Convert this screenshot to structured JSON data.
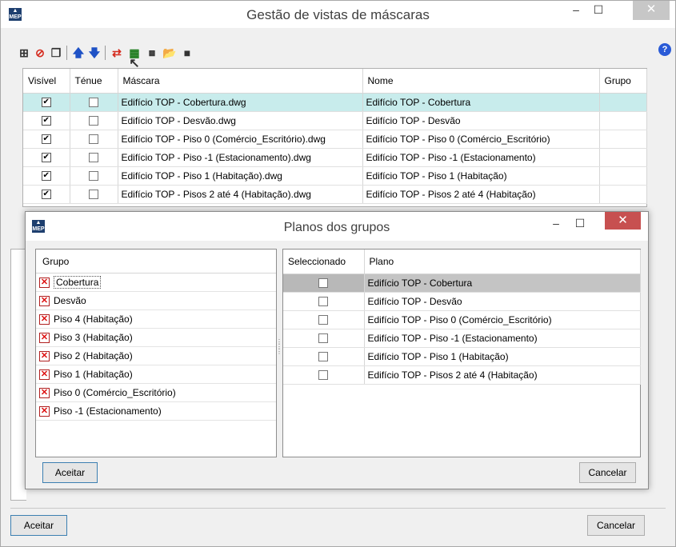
{
  "main_window": {
    "title": "Gestão de vistas de máscaras",
    "app_icon": "MEP",
    "controls": {
      "minimize": "–",
      "maximize": "☐",
      "close": "✕"
    },
    "toolbar": {
      "icons": [
        "add-icon",
        "delete-icon",
        "copy-icon",
        "move-up-icon",
        "move-down-icon",
        "toggle-icon",
        "select-all-icon",
        "dxf-dwg-icon",
        "open-folder-icon",
        "save-icon"
      ]
    },
    "help_label": "?",
    "table": {
      "headers": [
        "Visível",
        "Ténue",
        "Máscara",
        "Nome",
        "Grupo"
      ],
      "rows": [
        {
          "visible": "✔",
          "tenue": "",
          "mascara": "Edifício TOP - Cobertura.dwg",
          "nome": "Edifício TOP - Cobertura",
          "grupo": ""
        },
        {
          "visible": "✔",
          "tenue": "",
          "mascara": "Edifício TOP - Desvão.dwg",
          "nome": "Edifício TOP - Desvão",
          "grupo": ""
        },
        {
          "visible": "✔",
          "tenue": "",
          "mascara": "Edifício TOP - Piso 0 (Comércio_Escritório).dwg",
          "nome": "Edifício TOP - Piso 0 (Comércio_Escritório)",
          "grupo": ""
        },
        {
          "visible": "✔",
          "tenue": "",
          "mascara": "Edifício TOP - Piso -1 (Estacionamento).dwg",
          "nome": "Edifício TOP - Piso -1 (Estacionamento)",
          "grupo": ""
        },
        {
          "visible": "✔",
          "tenue": "",
          "mascara": "Edifício TOP - Piso 1 (Habitação).dwg",
          "nome": "Edifício TOP - Piso 1 (Habitação)",
          "grupo": ""
        },
        {
          "visible": "✔",
          "tenue": "",
          "mascara": "Edifício TOP - Pisos 2 até 4 (Habitação).dwg",
          "nome": "Edifício TOP - Pisos 2 até 4 (Habitação)",
          "grupo": ""
        }
      ]
    },
    "accept_label": "Aceitar",
    "cancel_label": "Cancelar"
  },
  "dialog": {
    "title": "Planos dos grupos",
    "app_icon": "MEP",
    "controls": {
      "minimize": "–",
      "maximize": "☐",
      "close": "✕"
    },
    "groups_header": "Grupo",
    "groups": [
      {
        "label": "Cobertura",
        "mark": "✕"
      },
      {
        "label": "Desvão",
        "mark": "✕"
      },
      {
        "label": "Piso 4 (Habitação)",
        "mark": "✕"
      },
      {
        "label": "Piso 3 (Habitação)",
        "mark": "✕"
      },
      {
        "label": "Piso 2 (Habitação)",
        "mark": "✕"
      },
      {
        "label": "Piso 1 (Habitação)",
        "mark": "✕"
      },
      {
        "label": "Piso 0 (Comércio_Escritório)",
        "mark": "✕"
      },
      {
        "label": "Piso -1 (Estacionamento)",
        "mark": "✕"
      }
    ],
    "plans_headers": [
      "Seleccionado",
      "Plano"
    ],
    "plans": [
      {
        "selected": "",
        "plano": "Edifício TOP - Cobertura"
      },
      {
        "selected": "",
        "plano": "Edifício TOP - Desvão"
      },
      {
        "selected": "",
        "plano": "Edifício TOP - Piso 0 (Comércio_Escritório)"
      },
      {
        "selected": "",
        "plano": "Edifício TOP - Piso -1 (Estacionamento)"
      },
      {
        "selected": "",
        "plano": "Edifício TOP - Piso 1 (Habitação)"
      },
      {
        "selected": "",
        "plano": "Edifício TOP - Pisos 2 até 4 (Habitação)"
      }
    ],
    "accept_label": "Aceitar",
    "cancel_label": "Cancelar"
  }
}
